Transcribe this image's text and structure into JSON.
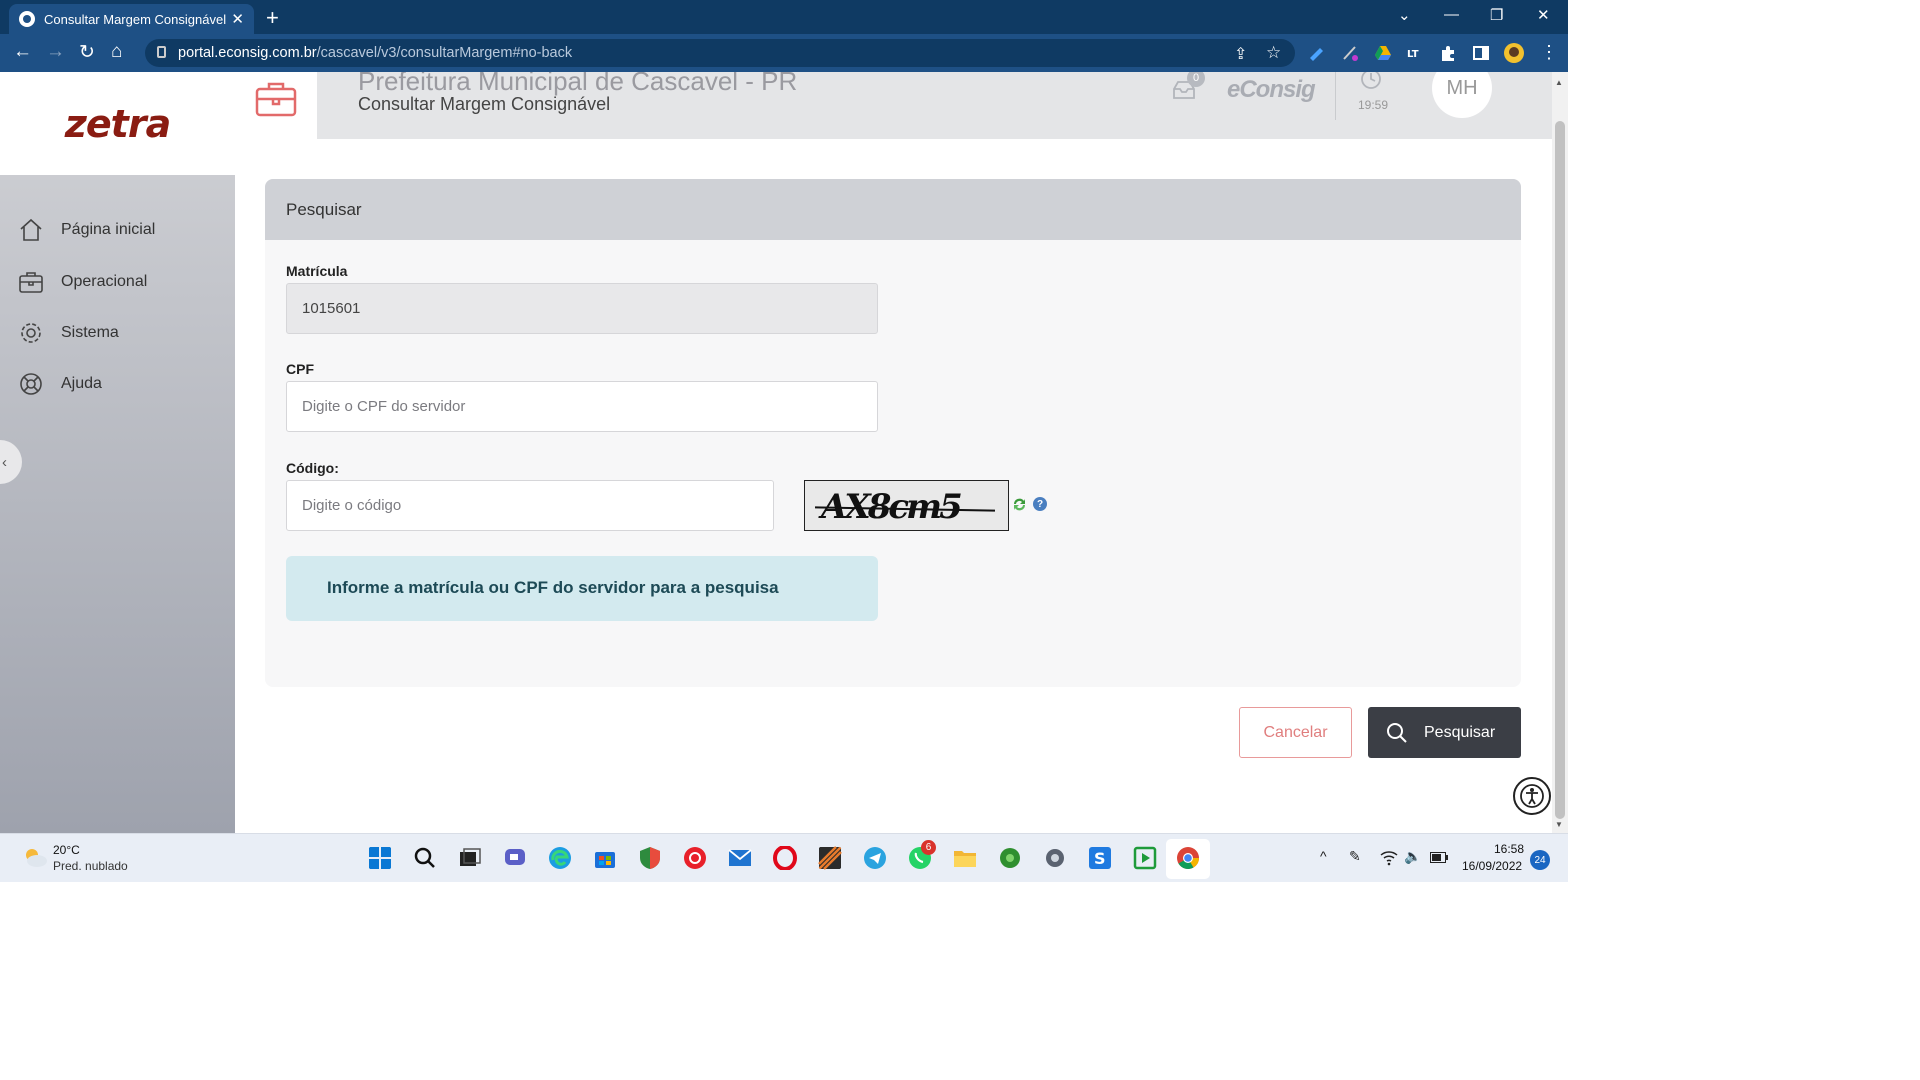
{
  "browser": {
    "tab_title": "Consultar Margem Consignável",
    "tab_close": "✕",
    "new_tab": "+",
    "url_domain": "portal.econsig.com.br",
    "url_path": "/cascavel/v3/consultarMargem#no-back"
  },
  "sidebar": {
    "logo": "zetra",
    "items": [
      {
        "label": "Página inicial",
        "icon": "home-icon"
      },
      {
        "label": "Operacional",
        "icon": "briefcase-icon"
      },
      {
        "label": "Sistema",
        "icon": "gear-icon"
      },
      {
        "label": "Ajuda",
        "icon": "lifebuoy-icon"
      }
    ]
  },
  "header": {
    "org": "Prefeitura Municipal de Cascavel - PR",
    "page": "Consultar Margem Consignável",
    "messages_count": "0",
    "brand": "eConsig",
    "session_time": "19:59",
    "user_initials": "MH"
  },
  "form": {
    "title": "Pesquisar",
    "matricula_label": "Matrícula",
    "matricula_value": "1015601",
    "cpf_label": "CPF",
    "cpf_placeholder": "Digite o CPF do servidor",
    "codigo_label": "Código:",
    "codigo_placeholder": "Digite o código",
    "captcha_text": "AX8cm5",
    "info_message": "Informe a matrícula ou CPF do servidor para a pesquisa"
  },
  "actions": {
    "cancel": "Cancelar",
    "search": "Pesquisar"
  },
  "taskbar": {
    "weather_temp": "20°C",
    "weather_desc": "Pred. nublado",
    "whatsapp_badge": "6",
    "time": "16:58",
    "date": "16/09/2022",
    "notifications": "24"
  },
  "colors": {
    "chrome": "#0f3a63",
    "brand_logo": "#8a1c12",
    "info_bg": "#d3eaef",
    "primary_button": "#3b3e45",
    "cancel_border": "#e89a9a"
  }
}
